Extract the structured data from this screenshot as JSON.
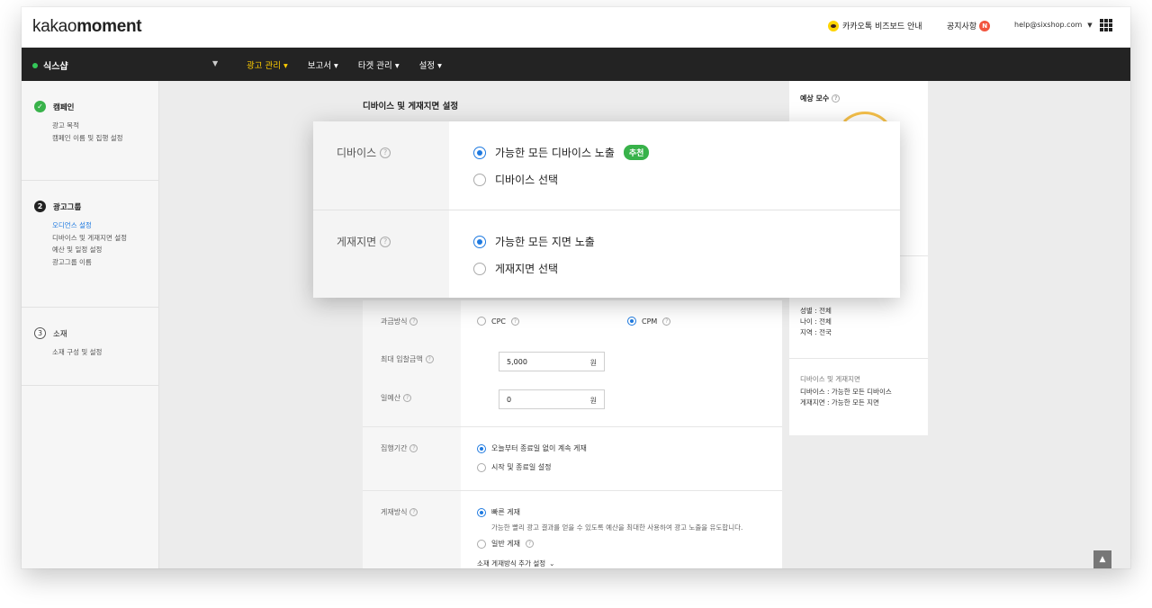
{
  "header": {
    "logo_light": "kakao",
    "logo_bold": "moment",
    "biz_label": "카카오톡 비즈보드 안내",
    "notice_label": "공지사항",
    "notice_badge": "N",
    "account_email": "help@sixshop.com"
  },
  "nav": {
    "shop_name": "식스샵",
    "menu": [
      "광고 관리",
      "보고서",
      "타겟 관리",
      "설정"
    ]
  },
  "sidebar": {
    "campaign": {
      "title": "캠페인",
      "items": [
        "광고 목적",
        "캠페인 이름 및 집행 설정"
      ]
    },
    "adgroup": {
      "step": "2",
      "title": "광고그룹",
      "items": [
        "오디언스 설정",
        "디바이스 및 게재지면 설정",
        "예산 및 일정 설정",
        "광고그룹 이름"
      ]
    },
    "creative": {
      "step": "3",
      "title": "소재",
      "items": [
        "소재 구성 및 설정"
      ]
    }
  },
  "form": {
    "title": "디바이스 및 게재지면 설정",
    "billing_label": "과금방식",
    "billing_options": [
      "CPC",
      "CPM"
    ],
    "max_bid_label": "최대 입찰금액",
    "max_bid_value": "5,000",
    "currency": "원",
    "daily_budget_label": "일예산",
    "daily_budget_value": "0",
    "period_label": "집행기간",
    "period_options": [
      "오늘부터 종료일 없이 계속 게재",
      "시작 및 종료일 설정"
    ],
    "delivery_label": "게재방식",
    "delivery_fast": "빠른 게재",
    "delivery_fast_desc": "가능한 빨리 광고 결과를 얻을 수 있도록 예산을 최대한 사용하여 광고 노출을 유도합니다.",
    "delivery_normal": "일반 게재",
    "delivery_more": "소재 게재방식 추가 설정"
  },
  "summary": {
    "title": "예상 모수",
    "audience_lines": [
      "성별 : 전체",
      "나이 : 전체",
      "지역 : 전국"
    ],
    "device_title": "디바이스 및 게재지면",
    "device_lines": [
      "디바이스 : 가능한 모든 디바이스",
      "게재지면 : 가능한 모든 지면"
    ]
  },
  "popup": {
    "device_label": "디바이스",
    "device_all": "가능한 모든 디바이스 노출",
    "recommend": "추천",
    "device_select": "디바이스 선택",
    "placement_label": "게재지면",
    "placement_all": "가능한 모든 지면 노출",
    "placement_select": "게재지면 선택"
  },
  "colors": {
    "accent": "#1f7ae0",
    "nav_active": "#ffcd00",
    "badge_green": "#38b24a",
    "navbar": "#232323"
  }
}
